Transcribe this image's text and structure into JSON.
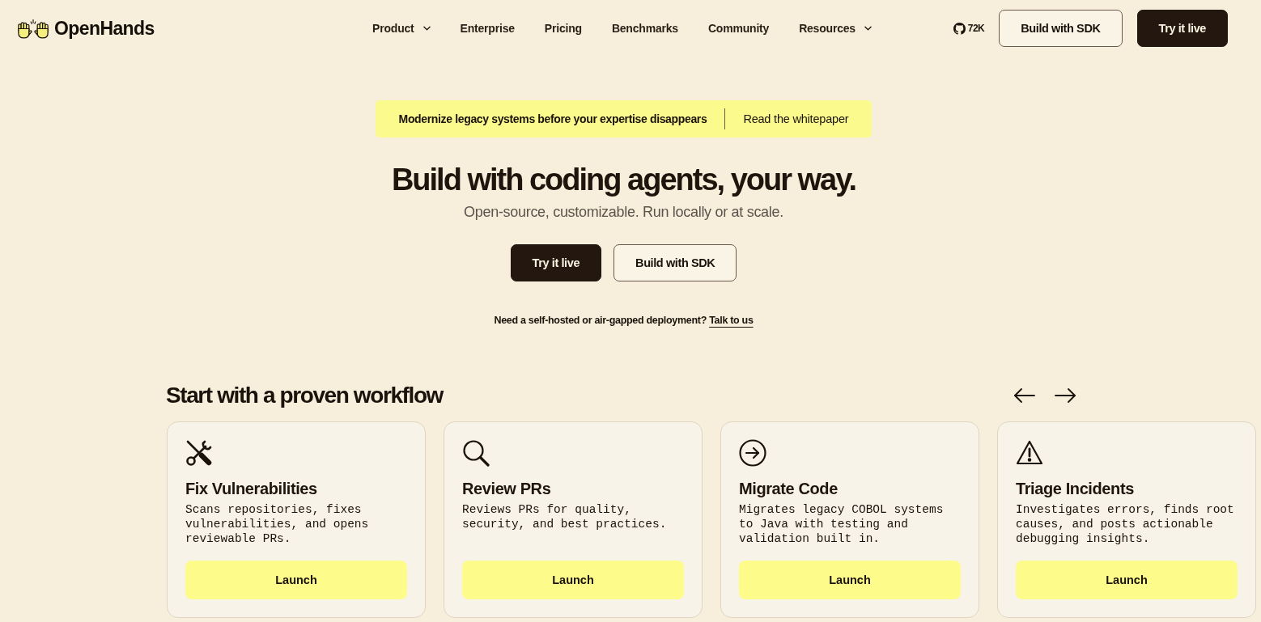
{
  "nav": {
    "logo": "OpenHands",
    "items": [
      {
        "label": "Product",
        "dropdown": true
      },
      {
        "label": "Enterprise",
        "dropdown": false
      },
      {
        "label": "Pricing",
        "dropdown": false
      },
      {
        "label": "Benchmarks",
        "dropdown": false
      },
      {
        "label": "Community",
        "dropdown": false
      },
      {
        "label": "Resources",
        "dropdown": true
      }
    ],
    "github_stars": "72K",
    "buttons": [
      {
        "label": "Build with SDK",
        "kind": "outline"
      },
      {
        "label": "Try it live",
        "kind": "primary"
      }
    ]
  },
  "banner": {
    "text": "Modernize legacy systems before your expertise disappears",
    "link": "Read the whitepaper"
  },
  "hero": {
    "title": "Build with coding agents, your way.",
    "subtitle": "Open-source, customizable. Run locally or at scale.",
    "buttons": [
      {
        "label": "Try it live",
        "kind": "primary"
      },
      {
        "label": "Build with SDK",
        "kind": "outline"
      }
    ],
    "note": "Need a self-hosted or air-gapped deployment?",
    "note_link": "Talk to us"
  },
  "workflows": {
    "title": "Start with a proven workflow",
    "cards": [
      {
        "title": "Fix Vulnerabilities",
        "description": "Scans repositories, fixes vulnerabilities, and opens reviewable PRs.",
        "button": "Launch"
      },
      {
        "title": "Review PRs",
        "description": "Reviews PRs for quality, security, and best practices.",
        "button": "Launch"
      },
      {
        "title": "Migrate Code",
        "description": "Migrates legacy COBOL systems to Java with testing and validation built in.",
        "button": "Launch"
      },
      {
        "title": "Triage Incidents",
        "description": "Investigates errors, finds root causes, and posts actionable debugging insights.",
        "button": "Launch"
      }
    ]
  }
}
